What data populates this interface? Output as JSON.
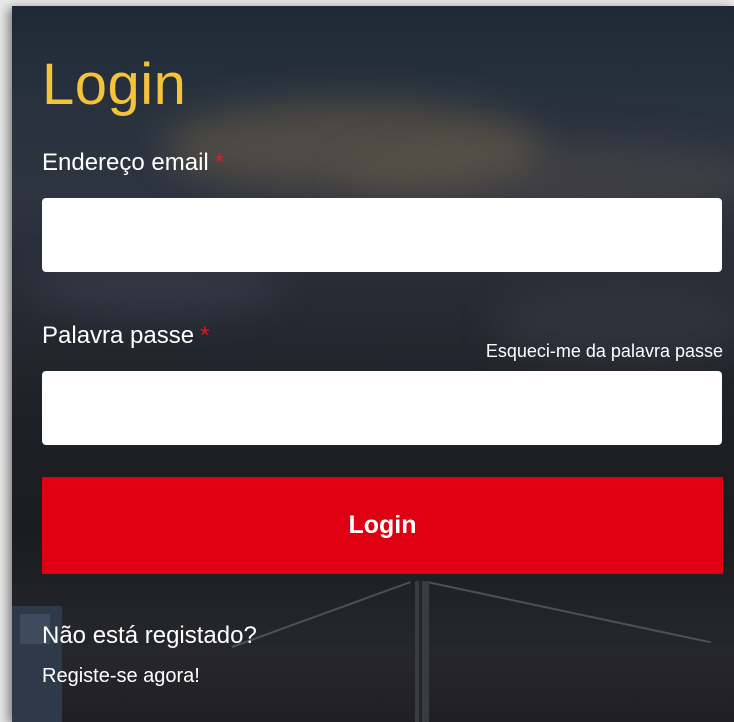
{
  "login": {
    "title": "Login",
    "email": {
      "label": "Endereço email",
      "required_mark": "*",
      "value": "",
      "placeholder": ""
    },
    "password": {
      "label": "Palavra passe",
      "required_mark": "*",
      "value": "",
      "placeholder": "",
      "forgot_link": "Esqueci-me da palavra passe"
    },
    "submit_label": "Login",
    "not_registered": "Não está registado?",
    "register_link": "Registe-se agora!"
  },
  "colors": {
    "title": "#f3c33a",
    "required": "#e01b1b",
    "button": "#df0012",
    "text": "#ffffff"
  }
}
